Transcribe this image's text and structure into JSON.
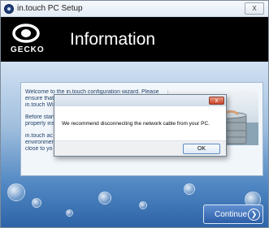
{
  "window": {
    "title": "in.touch PC Setup",
    "close_glyph": "X"
  },
  "header": {
    "logo_text": "GECKO",
    "title": "Information"
  },
  "panel": {
    "lines": [
      "Welcome to the in.touch configuration wizard. Please",
      "ensure that",
      "in.touch Wi",
      "Before start",
      "properly ins",
      "in.touch ac",
      "environmen",
      "close to yo"
    ]
  },
  "dialog": {
    "message": "We recommend disconnecting the network cable from your PC.",
    "ok_label": "OK",
    "close_glyph": "x"
  },
  "footer": {
    "continue_label": "Continue",
    "continue_icon_glyph": "❯"
  },
  "icons": {
    "app": "gecko-app-icon",
    "logo": "gecko-logo-icon",
    "continue": "arrow-right-circle-icon"
  },
  "colors": {
    "header_bg": "#000000",
    "accent_blue": "#2c5ea8",
    "panel_text": "#1f3f66",
    "dialog_close": "#c8452b"
  }
}
